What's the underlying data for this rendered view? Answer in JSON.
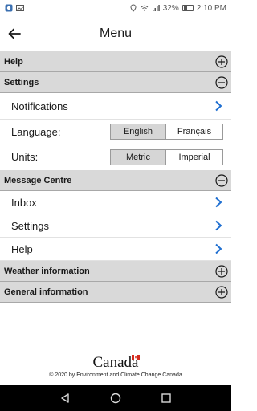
{
  "status_bar": {
    "battery": "32%",
    "time": "2:10 PM"
  },
  "header": {
    "title": "Menu"
  },
  "sections": {
    "help": {
      "label": "Help",
      "state": "collapsed"
    },
    "settings": {
      "label": "Settings",
      "state": "expanded",
      "notifications_label": "Notifications",
      "language_label": "Language:",
      "language_options": [
        "English",
        "Français"
      ],
      "language_selected": "English",
      "units_label": "Units:",
      "units_options": [
        "Metric",
        "Imperial"
      ],
      "units_selected": "Metric"
    },
    "message_centre": {
      "label": "Message Centre",
      "state": "expanded",
      "items": [
        "Inbox",
        "Settings",
        "Help"
      ]
    },
    "weather_information": {
      "label": "Weather information",
      "state": "collapsed"
    },
    "general_information": {
      "label": "General information",
      "state": "collapsed"
    }
  },
  "footer": {
    "wordmark": "Canada",
    "copyright": "© 2020 by Environment and Climate Change Canada"
  },
  "colors": {
    "section_bg": "#d9d9d9",
    "chevron": "#1f6fd1",
    "selected_segment": "#d6d6d6"
  },
  "icons": {
    "expand": "plus-circle-icon",
    "collapse": "minus-circle-icon",
    "row_chevron": "chevron-right-icon",
    "back": "arrow-left-icon"
  }
}
